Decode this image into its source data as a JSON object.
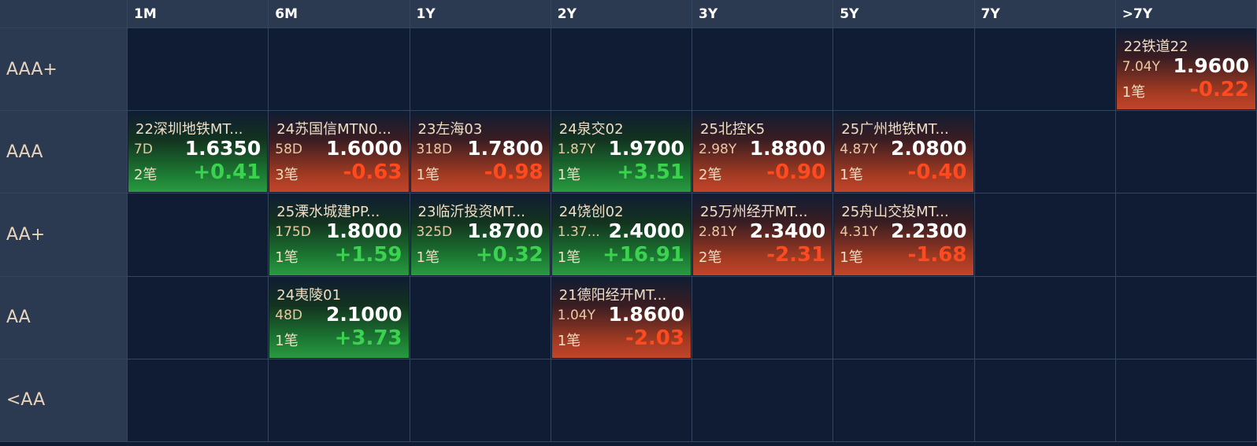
{
  "columns": [
    "1M",
    "6M",
    "1Y",
    "2Y",
    "3Y",
    "5Y",
    "7Y",
    ">7Y"
  ],
  "rows": [
    "AAA+",
    "AAA",
    "AA+",
    "AA",
    "<AA"
  ],
  "colors": {
    "up": "#3bd24f",
    "down": "#ff4a1f",
    "header_bg": "#2b3a51",
    "cell_bg": "#0f1c33"
  },
  "cards": [
    {
      "row": 0,
      "col": 7,
      "name": "22铁道22",
      "term": "7.04Y",
      "price": "1.9600",
      "count": "1笔",
      "change": "-0.22",
      "trend": "down"
    },
    {
      "row": 1,
      "col": 0,
      "name": "22深圳地铁MT...",
      "term": "7D",
      "price": "1.6350",
      "count": "2笔",
      "change": "+0.41",
      "trend": "up"
    },
    {
      "row": 1,
      "col": 1,
      "name": "24苏国信MTN0...",
      "term": "58D",
      "price": "1.6000",
      "count": "3笔",
      "change": "-0.63",
      "trend": "down"
    },
    {
      "row": 1,
      "col": 2,
      "name": "23左海03",
      "term": "318D",
      "price": "1.7800",
      "count": "1笔",
      "change": "-0.98",
      "trend": "down"
    },
    {
      "row": 1,
      "col": 3,
      "name": "24泉交02",
      "term": "1.87Y",
      "price": "1.9700",
      "count": "1笔",
      "change": "+3.51",
      "trend": "up"
    },
    {
      "row": 1,
      "col": 4,
      "name": "25北控K5",
      "term": "2.98Y",
      "price": "1.8800",
      "count": "2笔",
      "change": "-0.90",
      "trend": "down"
    },
    {
      "row": 1,
      "col": 5,
      "name": "25广州地铁MT...",
      "term": "4.87Y",
      "price": "2.0800",
      "count": "1笔",
      "change": "-0.40",
      "trend": "down"
    },
    {
      "row": 2,
      "col": 1,
      "name": "25溧水城建PP...",
      "term": "175D",
      "price": "1.8000",
      "count": "1笔",
      "change": "+1.59",
      "trend": "up"
    },
    {
      "row": 2,
      "col": 2,
      "name": "23临沂投资MT...",
      "term": "325D",
      "price": "1.8700",
      "count": "1笔",
      "change": "+0.32",
      "trend": "up"
    },
    {
      "row": 2,
      "col": 3,
      "name": "24饶创02",
      "term": "1.37...",
      "price": "2.4000",
      "count": "1笔",
      "change": "+16.91",
      "trend": "up"
    },
    {
      "row": 2,
      "col": 4,
      "name": "25万州经开MT...",
      "term": "2.81Y",
      "price": "2.3400",
      "count": "2笔",
      "change": "-2.31",
      "trend": "down"
    },
    {
      "row": 2,
      "col": 5,
      "name": "25舟山交投MT...",
      "term": "4.31Y",
      "price": "2.2300",
      "count": "1笔",
      "change": "-1.68",
      "trend": "down"
    },
    {
      "row": 3,
      "col": 1,
      "name": "24夷陵01",
      "term": "48D",
      "price": "2.1000",
      "count": "1笔",
      "change": "+3.73",
      "trend": "up"
    },
    {
      "row": 3,
      "col": 3,
      "name": "21德阳经开MT...",
      "term": "1.04Y",
      "price": "1.8600",
      "count": "1笔",
      "change": "-2.03",
      "trend": "down"
    }
  ]
}
